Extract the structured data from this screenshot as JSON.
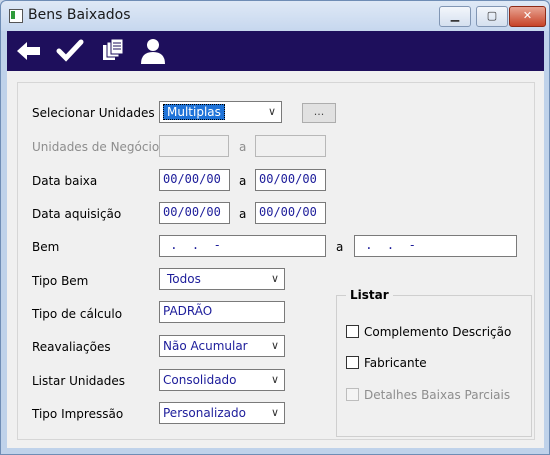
{
  "window": {
    "title": "Bens Baixados"
  },
  "toolbar": {
    "back_icon": "arrow-left-icon",
    "confirm_icon": "checkmark-icon",
    "copy_icon": "documents-icon",
    "user_icon": "user-icon"
  },
  "form": {
    "selecionar_unidades": {
      "label": "Selecionar Unidades",
      "value": "Multiplas",
      "button": "..."
    },
    "unidades_negocio": {
      "label": "Unidades de Negócio",
      "from": "",
      "sep": "a",
      "to": ""
    },
    "data_baixa": {
      "label": "Data baixa",
      "from": "00/00/00",
      "sep": "a",
      "to": "00/00/00"
    },
    "data_aquisicao": {
      "label": "Data aquisição",
      "from": "00/00/00",
      "sep": "a",
      "to": "00/00/00"
    },
    "bem": {
      "label": "Bem",
      "from": " .  .  -",
      "sep": "a",
      "to": " .  .  -"
    },
    "tipo_bem": {
      "label": "Tipo Bem",
      "value": "Todos"
    },
    "tipo_calculo": {
      "label": "Tipo de cálculo",
      "value": "PADRÃO"
    },
    "reavaliacoes": {
      "label": "Reavaliações",
      "value": "Não Acumular"
    },
    "listar_unidades": {
      "label": "Listar Unidades",
      "value": "Consolidado"
    },
    "tipo_impressao": {
      "label": "Tipo Impressão",
      "value": "Personalizado"
    }
  },
  "listar": {
    "title": "Listar",
    "complemento": {
      "label": "Complemento Descrição",
      "checked": false
    },
    "fabricante": {
      "label": "Fabricante",
      "checked": false
    },
    "detalhes": {
      "label": "Detalhes Baixas Parciais",
      "checked": false,
      "disabled": true
    }
  }
}
